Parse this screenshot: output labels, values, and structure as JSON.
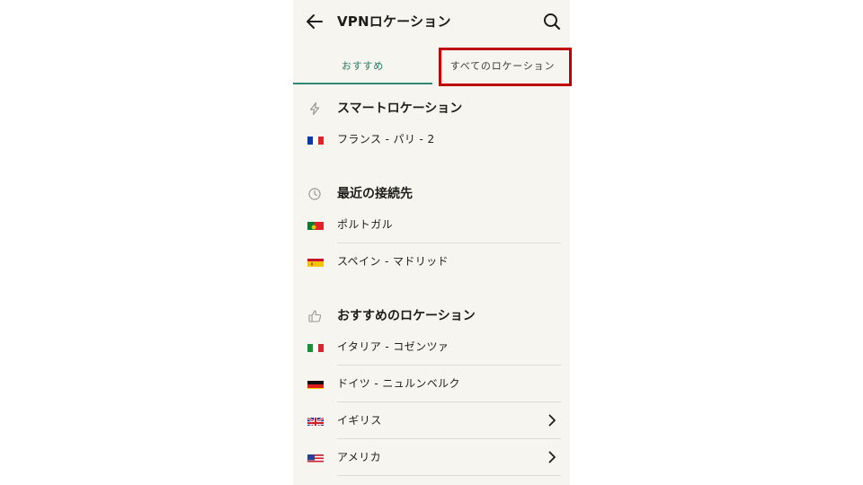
{
  "header": {
    "title": "VPNロケーション",
    "back_icon": "arrow-left-icon",
    "search_icon": "search-icon"
  },
  "tabs": [
    {
      "label": "おすすめ",
      "selected": true
    },
    {
      "label": "すべてのロケーション",
      "selected": false,
      "highlighted": true
    }
  ],
  "colors": {
    "accent": "#2f8a73",
    "highlight_border": "#c00000",
    "background": "#f6f5f0",
    "text": "#1d1d1b"
  },
  "sections": {
    "smart": {
      "label": "スマートロケーション",
      "icon": "lightning-icon",
      "items": [
        {
          "label": "フランス - パリ - 2",
          "flag": "france-flag-icon"
        }
      ]
    },
    "recent": {
      "label": "最近の接続先",
      "icon": "clock-icon",
      "items": [
        {
          "label": "ポルトガル",
          "flag": "portugal-flag-icon"
        },
        {
          "label": "スペイン - マドリッド",
          "flag": "spain-flag-icon"
        }
      ]
    },
    "recommended": {
      "label": "おすすめのロケーション",
      "icon": "thumbs-up-icon",
      "items": [
        {
          "label": "イタリア - コゼンツァ",
          "flag": "italy-flag-icon",
          "chevron": false
        },
        {
          "label": "ドイツ - ニュルンベルク",
          "flag": "germany-flag-icon",
          "chevron": false
        },
        {
          "label": "イギリス",
          "flag": "uk-flag-icon",
          "chevron": true
        },
        {
          "label": "アメリカ",
          "flag": "usa-flag-icon",
          "chevron": true
        }
      ]
    }
  }
}
